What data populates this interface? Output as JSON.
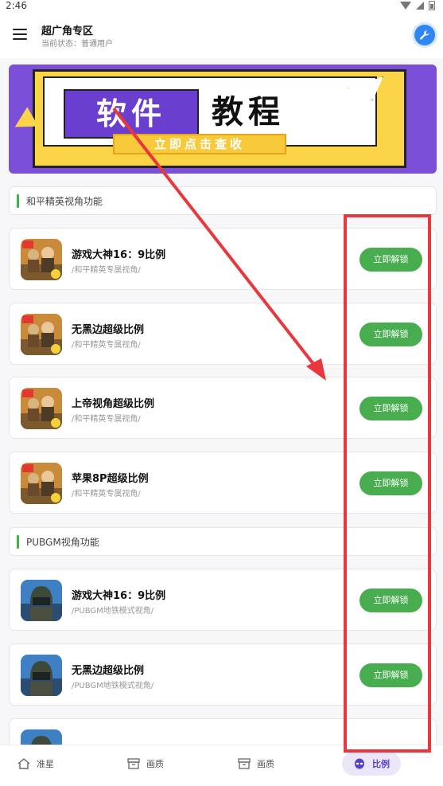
{
  "status_bar": {
    "time": "2:46"
  },
  "header": {
    "title": "超广角专区",
    "subtitle": "当前状态：普通用户"
  },
  "banner": {
    "word1": "软件",
    "word2": "教程",
    "cta": "立即点击查收"
  },
  "sections": [
    {
      "title": "和平精英视角功能",
      "items": [
        {
          "title": "游戏大神16：9比例",
          "subtitle": "/和平精英专属视角/",
          "button": "立即解锁"
        },
        {
          "title": "无黑边超级比例",
          "subtitle": "/和平精英专属视角/",
          "button": "立即解锁"
        },
        {
          "title": "上帝视角超级比例",
          "subtitle": "/和平精英专属视角/",
          "button": "立即解锁"
        },
        {
          "title": "苹果8P超级比例",
          "subtitle": "/和平精英专属视角/",
          "button": "立即解锁"
        }
      ]
    },
    {
      "title": "PUBGM视角功能",
      "items": [
        {
          "title": "游戏大神16：9比例",
          "subtitle": "/PUBGM地铁模式视角/",
          "button": "立即解锁"
        },
        {
          "title": "无黑边超级比例",
          "subtitle": "/PUBGM地铁模式视角/",
          "button": "立即解锁"
        }
      ]
    }
  ],
  "bottom_nav": [
    {
      "label": "准星",
      "icon": "home-icon"
    },
    {
      "label": "画质",
      "icon": "archive-icon"
    },
    {
      "label": "画质",
      "icon": "archive-icon"
    },
    {
      "label": "比例",
      "icon": "alien-icon",
      "active": true
    }
  ],
  "colors": {
    "accent_green": "#47ad4e",
    "banner_purple": "#7b4fd8",
    "annotation_red": "#e8383d",
    "nav_active": "#5b3fc4"
  }
}
